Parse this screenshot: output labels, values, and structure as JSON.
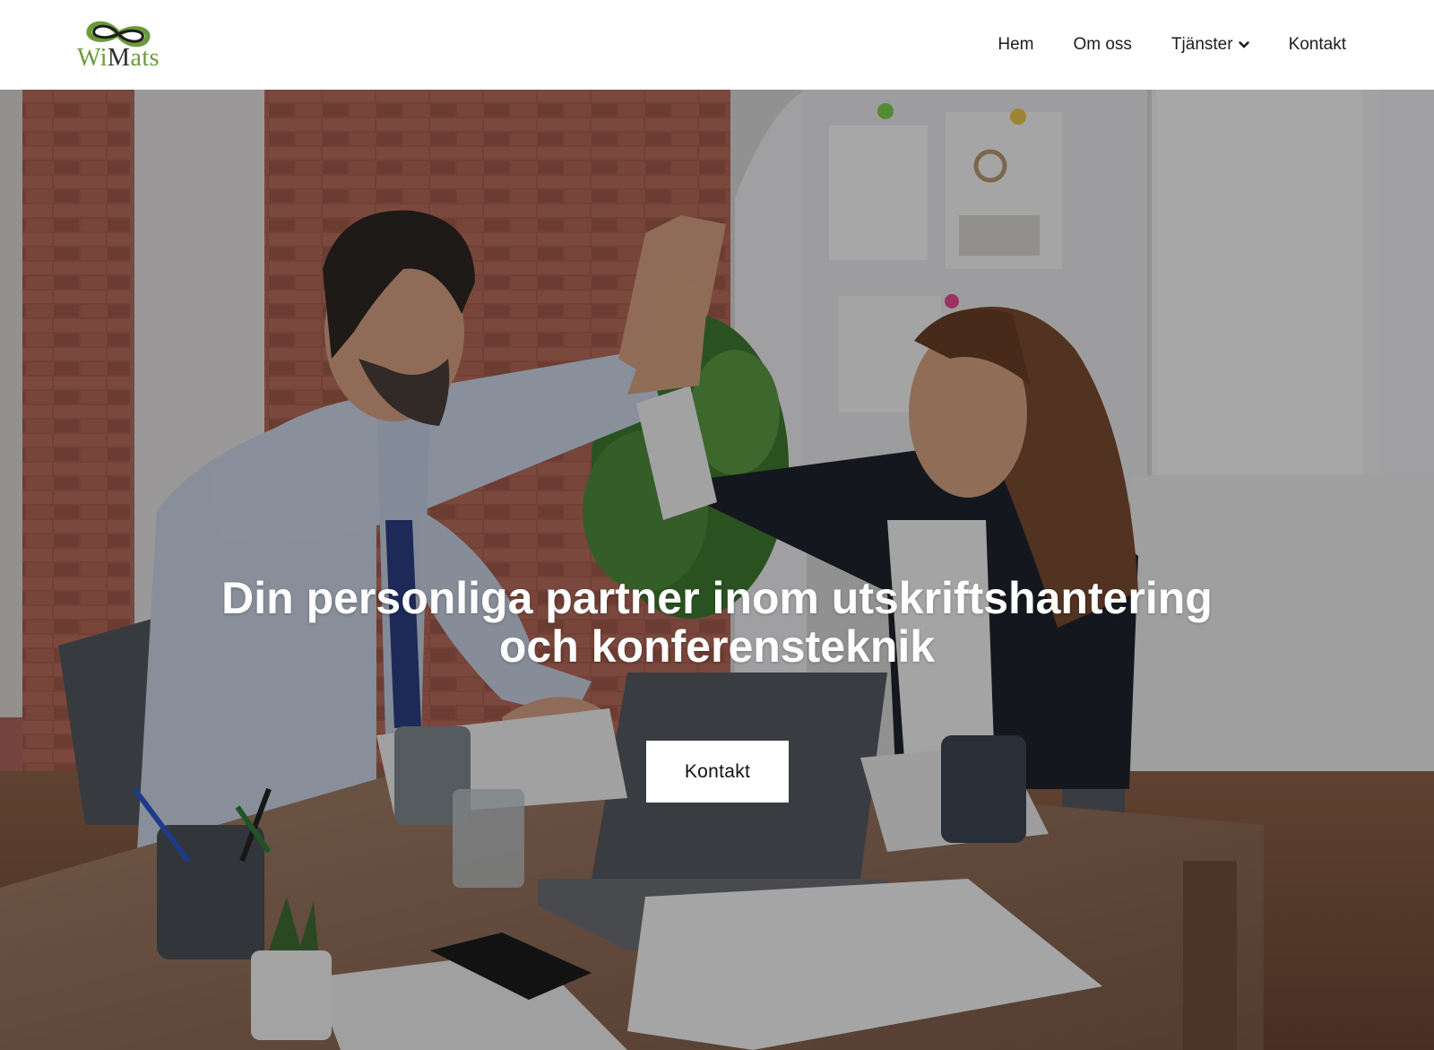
{
  "header": {
    "logo": {
      "text_part1": "Wi",
      "text_part2": "M",
      "text_part3": "ats",
      "icon": "infinity-leaf-icon"
    },
    "nav": [
      {
        "label": "Hem"
      },
      {
        "label": "Om oss"
      },
      {
        "label": "Tjänster",
        "icon": "chevron-down-icon"
      },
      {
        "label": "Kontakt"
      }
    ]
  },
  "hero": {
    "title_line1": "Din personliga partner inom utskriftshantering",
    "title_line2": "och konferensteknik",
    "cta_label": "Kontakt",
    "image": "office-high-five-photo"
  },
  "colors": {
    "brand_green": "#6b9a3c",
    "brand_dark": "#2b2b2b",
    "nav_text": "#1c1c1c",
    "button_bg": "#ffffff"
  }
}
